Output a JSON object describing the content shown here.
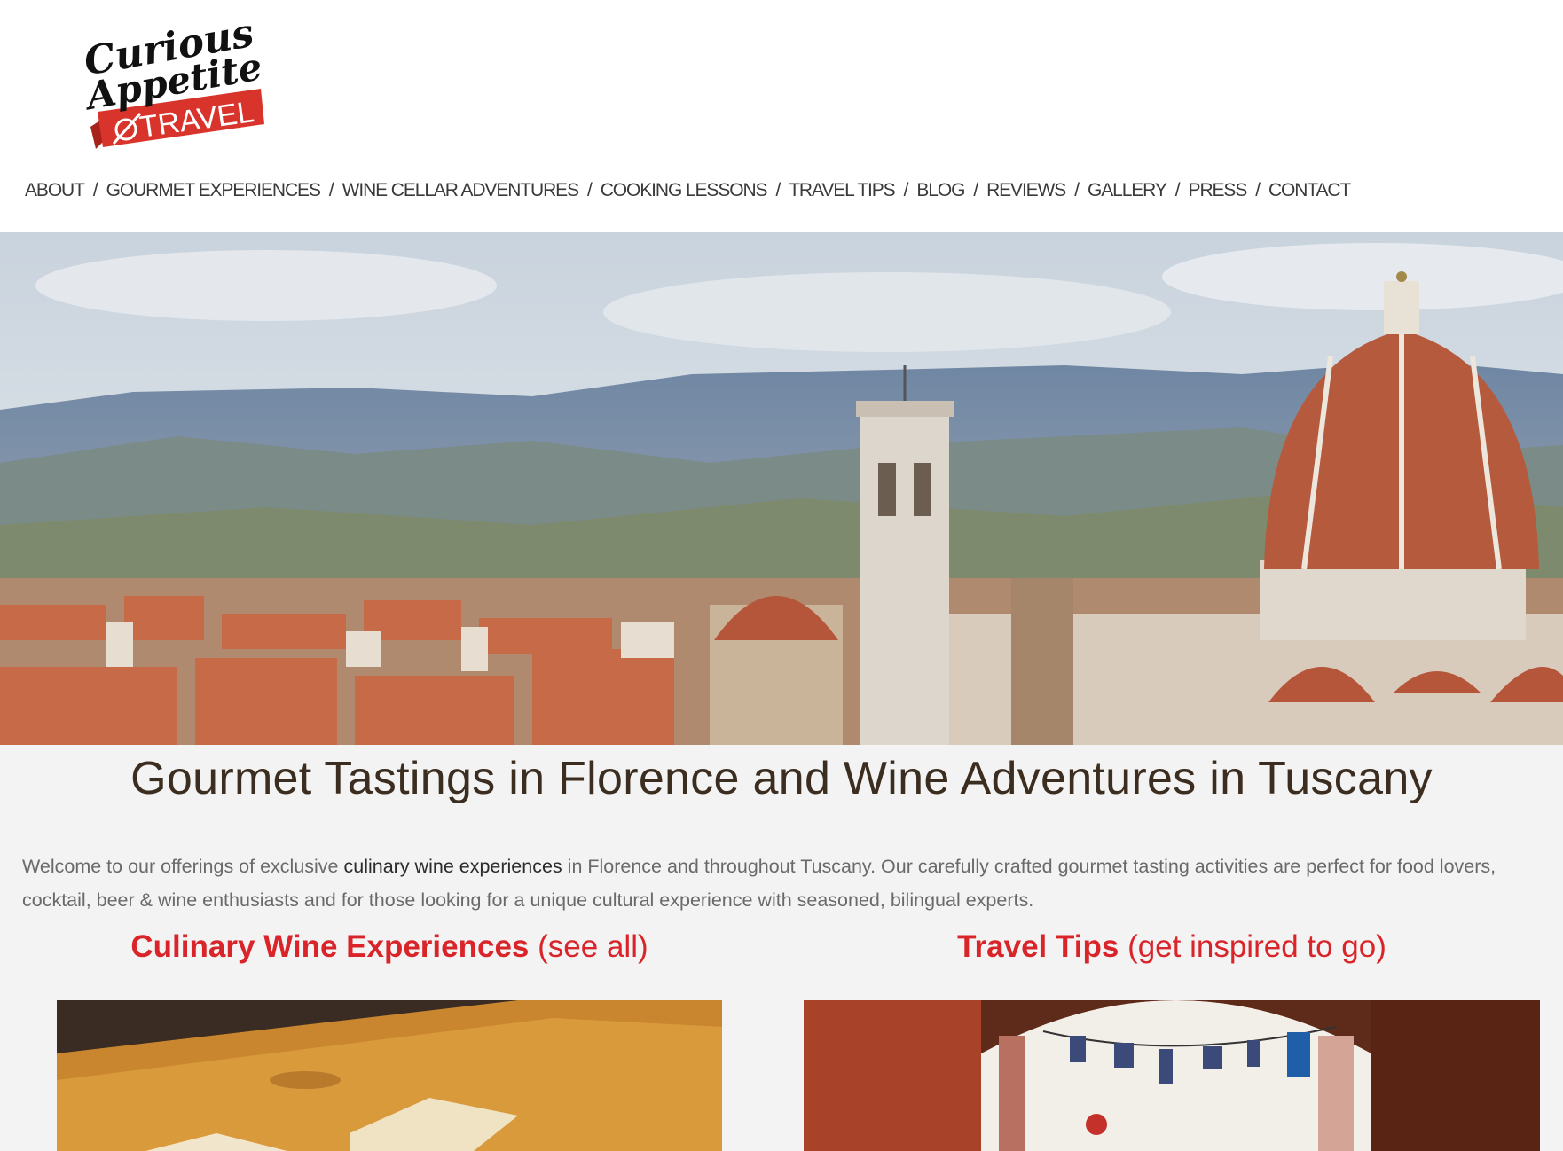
{
  "logo": {
    "line1": "Curious",
    "line2": "Appetite",
    "banner": "TRAVEL",
    "colors": {
      "banner": "#d9342b",
      "script": "#111111"
    }
  },
  "nav": {
    "items": [
      "ABOUT",
      "GOURMET EXPERIENCES",
      "WINE CELLAR ADVENTURES",
      "COOKING LESSONS",
      "TRAVEL TIPS",
      "BLOG",
      "REVIEWS",
      "GALLERY",
      "PRESS",
      "CONTACT"
    ],
    "separator": "/"
  },
  "hero": {
    "icon": "florence-skyline-image"
  },
  "main": {
    "title": "Gourmet Tastings in Florence and Wine Adventures in Tuscany",
    "intro_before": "Welcome to our offerings of exclusive ",
    "intro_link": "culinary wine experiences",
    "intro_after": " in Florence and throughout Tuscany.  Our carefully crafted gourmet tasting activities are perfect for food lovers, cocktail, beer & wine enthusiasts and for those looking for a unique cultural experience with seasoned, bilingual experts.",
    "left_heading": "Culinary Wine Experiences",
    "left_link": "(see all)",
    "right_heading": "Travel Tips",
    "right_link": "(get inspired to go)"
  },
  "colors": {
    "accent": "#d9252a",
    "background": "#f3f3f3",
    "title": "#3b2d1f"
  }
}
